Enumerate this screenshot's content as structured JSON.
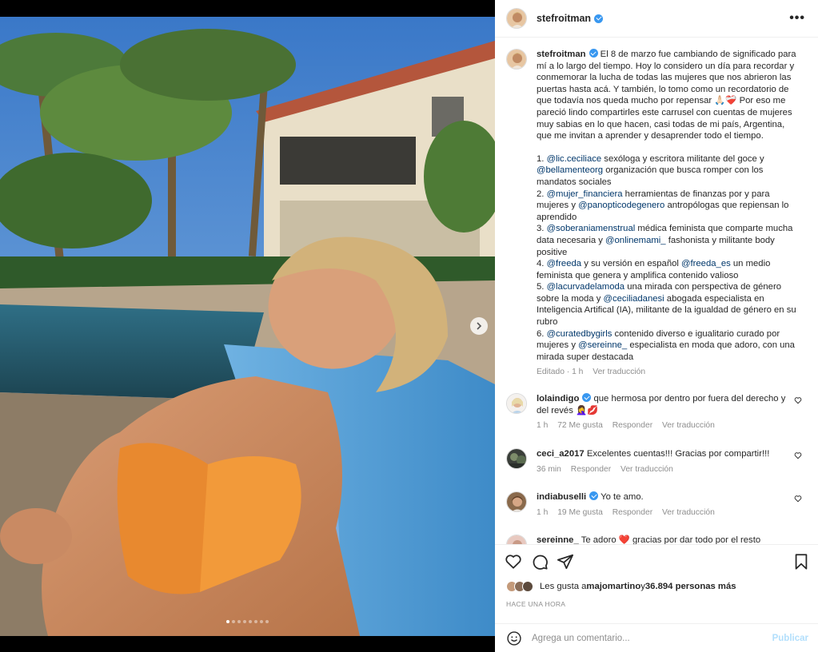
{
  "post": {
    "username": "stefroitman",
    "more_label": "•••",
    "caption": {
      "username": "stefroitman",
      "intro": " El 8 de marzo fue cambiando de significado para mí a lo largo del tiempo. Hoy lo considero un día para recordar y conmemorar la lucha de todas las mujeres que nos abrieron las puertas hasta acá. Y también, lo tomo como un recordatorio de que todavía nos queda mucho por repensar 🙏🏻❤️‍🩹 Por eso me pareció lindo compartirles este carrusel con cuentas de mujeres muy sabias en lo que hacen, casi todas de mi país, Argentina, que me invitan a aprender y desaprender todo el tiempo.",
      "l1a": "1. ",
      "m1": "@lic.ceciliace",
      "l1b": " sexóloga y escritora militante del goce y ",
      "m2": "@bellamenteorg",
      "l1c": " organización que busca romper con los mandatos sociales",
      "l2a": "2. ",
      "m3": "@mujer_financiera",
      "l2b": " herramientas de finanzas por y para mujeres y ",
      "m4": "@panopticodegenero",
      "l2c": " antropólogas que repiensan lo aprendido",
      "l3a": "3. ",
      "m5": "@soberaniamenstrual",
      "l3b": " médica feminista que comparte mucha data necesaria y ",
      "m6": "@onlinemami_",
      "l3c": " fashonista y militante body positive",
      "l4a": "4. ",
      "m7": "@freeda",
      "l4b": " y su versión en español ",
      "m8": "@freeda_es",
      "l4c": " un medio feminista que genera y amplifica contenido valioso",
      "l5a": "5. ",
      "m9": "@lacurvadelamoda",
      "l5b": " una mirada con perspectiva de género sobre la moda y ",
      "m10": "@ceciliadanesi",
      "l5c": " abogada especialista en Inteligencia Artifical (IA), militante de la igualdad de género en su rubro",
      "l6a": "6. ",
      "m11": "@curatedbygirls",
      "l6b": " contenido diverso e igualitario curado por mujeres y ",
      "m12": "@sereinne_",
      "l6c": " especialista en moda que adoro, con una mirada super destacada",
      "edited": "Editado · 1 h",
      "translate": "Ver traducción"
    },
    "comments": [
      {
        "user": "lolaindigo",
        "text": " que hermosa por dentro por fuera del derecho y del revés 🤦‍♀️💋",
        "time": "1 h",
        "likes": "72 Me gusta",
        "reply": "Responder",
        "translate": "Ver traducción"
      },
      {
        "user": "ceci_a2017",
        "text": " Excelentes cuentas!!! Gracias por compartir!!!",
        "time": "36 min",
        "reply": "Responder",
        "translate": "Ver traducción"
      },
      {
        "user": "indiabuselli",
        "text": " Yo te amo.",
        "time": "1 h",
        "likes": "19 Me gusta",
        "reply": "Responder",
        "translate": "Ver traducción"
      },
      {
        "user": "sereinne_",
        "text": " Te adoro ❤️ gracias por dar todo por el resto"
      }
    ],
    "likes": {
      "prefix": "Les gusta a ",
      "user": "majomartino",
      "mid": " y ",
      "count": "36.894 personas más"
    },
    "timestamp": "HACE UNA HORA",
    "comment_placeholder": "Agrega un comentario...",
    "publish_label": "Publicar",
    "carousel": {
      "total": 8,
      "active": 0
    }
  },
  "colors": {
    "verified": "#3897f0",
    "mention": "#00376b",
    "publish": "#b2dffc"
  }
}
